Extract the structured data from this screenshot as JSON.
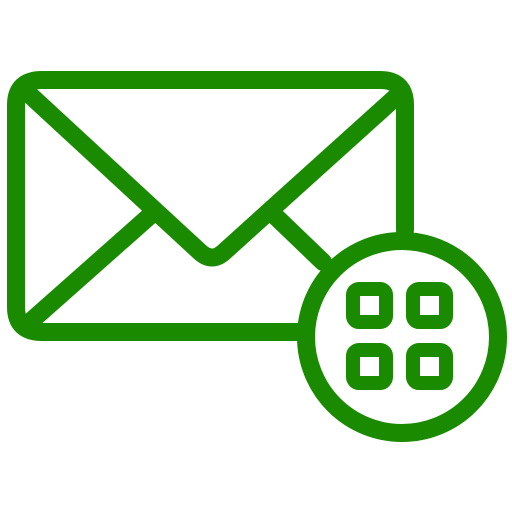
{
  "icon": {
    "name": "mail-apps-icon",
    "color": "#1a8a00",
    "background": "#ffffff",
    "parts": [
      "envelope-icon",
      "apps-grid-icon"
    ],
    "grid_cells": 4
  }
}
